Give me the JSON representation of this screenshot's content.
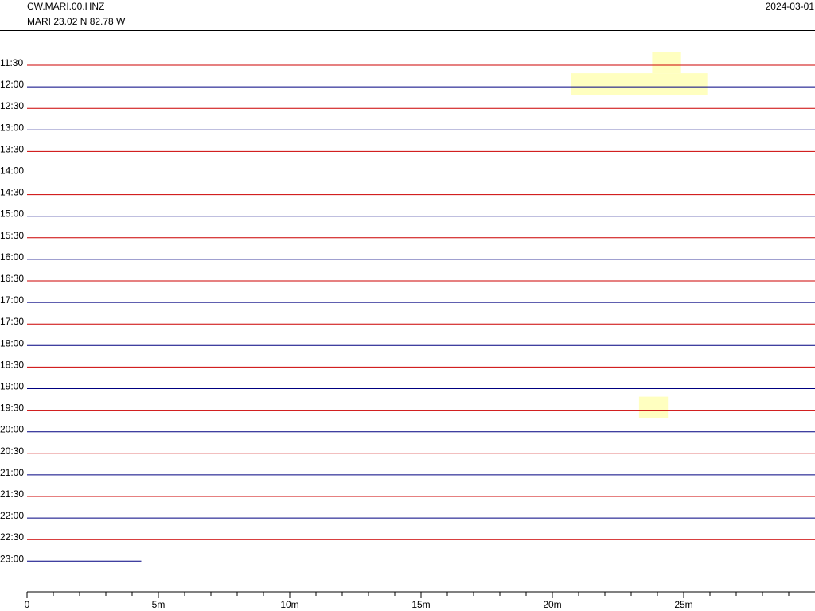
{
  "header": {
    "channel": "CW.MARI.00.HNZ",
    "station": "MARI  23.02 N 82.78 W",
    "date": "2024-03-01"
  },
  "colors": {
    "odd_trace": "#cc0000",
    "even_trace": "#000080",
    "highlight": "#ffffc0",
    "axis": "#000000"
  },
  "chart_data": {
    "type": "line",
    "title": "",
    "xlabel": "",
    "ylabel": "",
    "xlim": [
      0,
      30
    ],
    "x_unit": "minutes",
    "x_ticks": [
      0,
      5,
      10,
      15,
      20,
      25
    ],
    "x_tick_labels": [
      "0",
      "5m",
      "10m",
      "15m",
      "20m",
      "25m"
    ],
    "x_minor_tick_step": 1,
    "rows": [
      {
        "label": "11:30",
        "start": 0,
        "end": 30
      },
      {
        "label": "12:00",
        "start": 0,
        "end": 30
      },
      {
        "label": "12:30",
        "start": 0,
        "end": 30
      },
      {
        "label": "13:00",
        "start": 0,
        "end": 30
      },
      {
        "label": "13:30",
        "start": 0,
        "end": 30
      },
      {
        "label": "14:00",
        "start": 0,
        "end": 30
      },
      {
        "label": "14:30",
        "start": 0,
        "end": 30
      },
      {
        "label": "15:00",
        "start": 0,
        "end": 30
      },
      {
        "label": "15:30",
        "start": 0,
        "end": 30
      },
      {
        "label": "16:00",
        "start": 0,
        "end": 30
      },
      {
        "label": "16:30",
        "start": 0,
        "end": 30
      },
      {
        "label": "17:00",
        "start": 0,
        "end": 30
      },
      {
        "label": "17:30",
        "start": 0,
        "end": 30
      },
      {
        "label": "18:00",
        "start": 0,
        "end": 30
      },
      {
        "label": "18:30",
        "start": 0,
        "end": 30
      },
      {
        "label": "19:00",
        "start": 0,
        "end": 30
      },
      {
        "label": "19:30",
        "start": 0,
        "end": 30
      },
      {
        "label": "20:00",
        "start": 0,
        "end": 30
      },
      {
        "label": "20:30",
        "start": 0,
        "end": 30
      },
      {
        "label": "21:00",
        "start": 0,
        "end": 30
      },
      {
        "label": "21:30",
        "start": 0,
        "end": 30
      },
      {
        "label": "22:00",
        "start": 0,
        "end": 30
      },
      {
        "label": "22:30",
        "start": 0,
        "end": 30
      },
      {
        "label": "23:00",
        "start": 0,
        "end": 4.35
      }
    ],
    "highlights": [
      {
        "row": "11:30",
        "x_start": 23.8,
        "x_end": 24.9
      },
      {
        "row": "12:00",
        "x_start": 20.7,
        "x_end": 25.9
      },
      {
        "row": "19:30",
        "x_start": 23.3,
        "x_end": 24.4
      }
    ]
  }
}
